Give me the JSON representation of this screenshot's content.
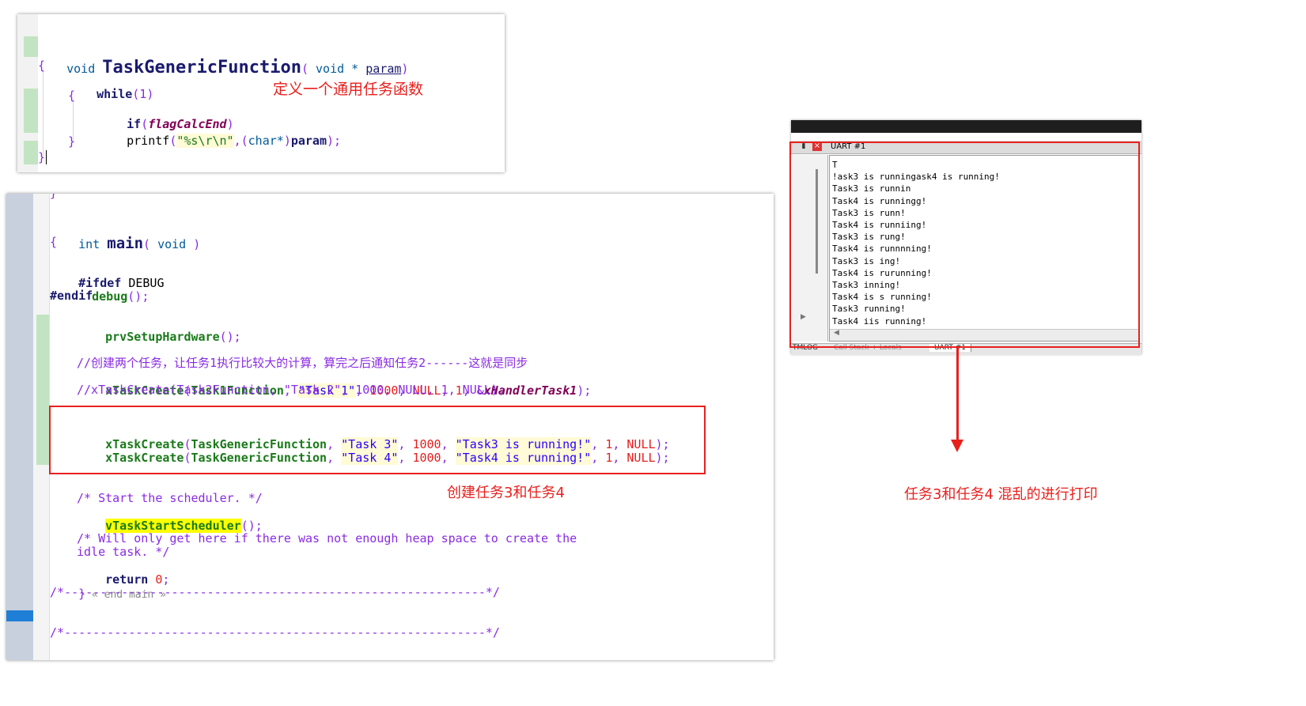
{
  "top_panel": {
    "lines": [
      {
        "void": "void ",
        "name": "TaskGenericFunction",
        "open": "( ",
        "void2": "void * ",
        "param": "param",
        "close": ")"
      },
      "{",
      "while",
      "(1)",
      "{",
      "if",
      "(",
      "flagCalcEnd",
      ")",
      "printf",
      "(",
      "\"%s\\r\\n\"",
      ",(",
      "char*",
      ")",
      "param",
      ");",
      "}",
      "}"
    ],
    "annotation": "定义一个通用任务函数"
  },
  "main_panel": {
    "prev_brace": "}",
    "int": "int ",
    "main": "main",
    "main_args_open": "( ",
    "main_void": "void",
    "main_args_close": " )",
    "open_brace": "{",
    "ifdef": "#ifdef",
    "debug_macro": " DEBUG",
    "debug_call": "debug",
    "debug_paren": "();",
    "endif": "#endif",
    "setup_fn": "prvSetupHardware",
    "setup_paren": "();",
    "comment_cn": "//创建两个任务，让任务1执行比较大的计算，算完之后通知任务2------这就是同步",
    "create1": {
      "fn": "xTaskCreate",
      "p1": "(",
      "arg1": "Task1Function",
      "c1": ", ",
      "s": "\"Task 1\"",
      "c2": ", ",
      "n1": "1000",
      "c3": ", ",
      "null": "NULL",
      "c4": ", ",
      "n2": "1",
      "c5": ", &",
      "h": "xHandlerTask1",
      "end": ");"
    },
    "create2_comment": "//xTaskCreate(Task2Function, \"Task 2\", 1000, NULL, 1, NULL);",
    "create3": {
      "fn": "xTaskCreate",
      "p1": "(",
      "arg1": "TaskGenericFunction",
      "c1": ", ",
      "s": "\"Task 3\"",
      "c2": ", ",
      "n1": "1000",
      "c3": ", ",
      "s2": "\"Task3 is running!\"",
      "c4": ", ",
      "n2": "1",
      "c5": ", ",
      "null": "NULL",
      "end": ");"
    },
    "create4": {
      "fn": "xTaskCreate",
      "p1": "(",
      "arg1": "TaskGenericFunction",
      "c1": ", ",
      "s": "\"Task 4\"",
      "c2": ", ",
      "n1": "1000",
      "c3": ", ",
      "s2": "\"Task4 is running!\"",
      "c4": ", ",
      "n2": "1",
      "c5": ", ",
      "null": "NULL",
      "end": ");"
    },
    "start_comment": "/* Start the scheduler. */",
    "start_fn": "vTaskStartScheduler",
    "start_paren": "();",
    "heap_comment_1": "/* Will only get here if there was not enough heap space to create the",
    "heap_comment_2": "idle task. */",
    "return_kw": "return",
    "return_val": " 0",
    "return_semi": ";",
    "end_main_brace": "}",
    "end_main_tag": " « end main »",
    "divider": "/*-----------------------------------------------------------*/",
    "annotation": "创建任务3和任务4"
  },
  "uart": {
    "title": "UART #1",
    "lines": [
      "T",
      "!ask3 is runningask4 is running!",
      "Task3 is runnin",
      "Task4 is runningg!",
      "Task3 is runn!",
      "Task4 is runniing!",
      "Task3 is rung!",
      "Task4 is runnnning!",
      "Task3 is ing!",
      "Task4 is rurunning!",
      "Task3 inning!",
      "Task4 is s running!",
      "Task3 running!",
      "Task4 iis running!"
    ],
    "tabs": [
      "TMLOG",
      "Call Stack + Locals",
      "UART #1"
    ],
    "annotation": "任务3和任务4 混乱的进行打印"
  },
  "colors": {
    "annotation_red": "#e8201d",
    "gutter_green": "#c2e4c2",
    "gutter_blue": "#1f7fd6"
  }
}
